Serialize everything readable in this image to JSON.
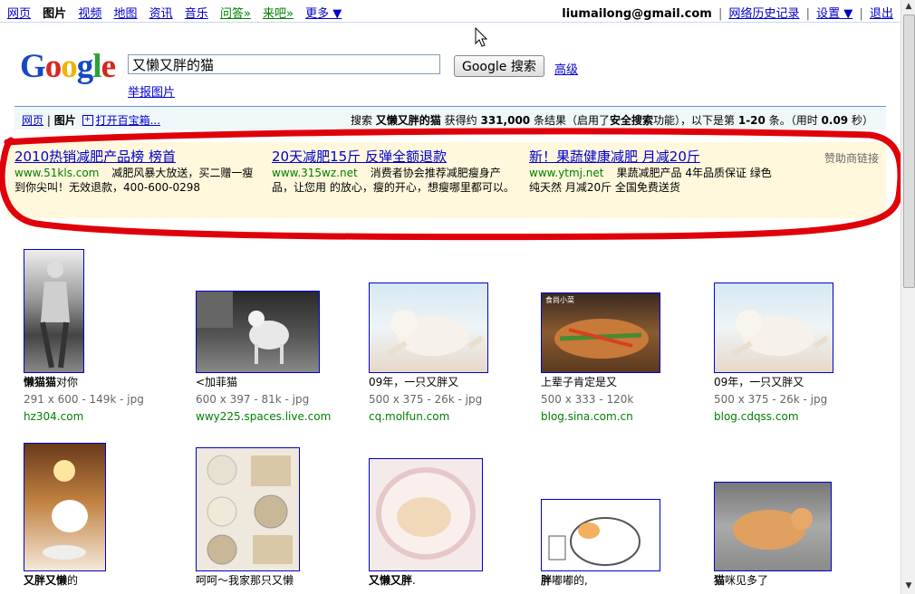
{
  "topnav": {
    "items": [
      "网页",
      "图片",
      "视频",
      "地图",
      "资讯",
      "音乐",
      "问答»",
      "来吧»",
      "更多 ▼"
    ],
    "account_email": "liumailong@gmail.com",
    "history": "网络历史记录",
    "settings": "设置 ▼",
    "signout": "退出"
  },
  "search": {
    "query": "又懒又胖的猫",
    "button": "Google 搜索",
    "advanced": "高级",
    "report": "举报图片"
  },
  "logo": {
    "l1": "G",
    "l2": "o",
    "l3": "o",
    "l4": "g",
    "l5": "l",
    "l6": "e"
  },
  "resultbar": {
    "tab_web": "网页",
    "sep": "|",
    "tab_images": "图片",
    "toolbox": "打开百宝箱...",
    "summary_prefix": "搜索",
    "summary_query": "又懒又胖的猫",
    "summary_mid1": "获得约",
    "summary_count": "331,000",
    "summary_mid2": "条结果（启用了",
    "summary_safe": "安全搜索",
    "summary_mid3": "功能），以下是第",
    "summary_range": "1-20",
    "summary_end": "条。（用时",
    "summary_time": "0.09",
    "summary_sec": "秒）"
  },
  "ads": {
    "sponsor_label": "赞助商链接",
    "items": [
      {
        "title": "2010热销减肥产品榜 榜首",
        "url": "www.51kls.com",
        "desc": "减肥风暴大放送，买二赠一瘦到你尖叫！无效退款，400-600-0298"
      },
      {
        "title": "20天减肥15斤 反弹全额退款",
        "url": "www.315wz.net",
        "desc": "消费者协会推荐减肥瘦身产品，让您用 的放心，瘦的开心，想瘦哪里都可以。"
      },
      {
        "title": "新！果蔬健康减肥 月减20斤",
        "url": "www.ytmj.net",
        "desc": "果蔬减肥产品 4年品质保证 绿色纯天然 月减20斤 全国免费送货"
      }
    ]
  },
  "images": [
    {
      "title_bold": "懒猫猫",
      "title_rest": "对你",
      "meta": "291 x 600 - 149k - jpg",
      "host": "hz304.com"
    },
    {
      "title_bold": "",
      "title_rest": "<加菲猫",
      "meta": "600 x 397 - 81k - jpg",
      "host": "wwy225.spaces.live.com"
    },
    {
      "title_bold": "",
      "title_rest": "09年，一只又胖又",
      "meta": "500 x 375 - 26k - jpg",
      "host": "cq.molfun.com"
    },
    {
      "title_bold": "",
      "title_rest": "上辈子肯定是又",
      "meta": "500 x 333 - 120k",
      "host": "blog.sina.com.cn"
    },
    {
      "title_bold": "",
      "title_rest": "09年，一只又胖又",
      "meta": "500 x 375 - 26k - jpg",
      "host": "blog.cdqss.com"
    },
    {
      "title_bold": "又胖又懒",
      "title_rest": "的",
      "meta": "",
      "host": ""
    },
    {
      "title_bold": "",
      "title_rest": "呵呵～我家那只又懒",
      "meta": "",
      "host": ""
    },
    {
      "title_bold": "又懒又胖",
      "title_rest": ".",
      "meta": "",
      "host": ""
    },
    {
      "title_bold": "胖",
      "title_rest": "嘟嘟的,",
      "meta": "",
      "host": ""
    },
    {
      "title_bold": "猫",
      "title_rest": "咪见多了",
      "meta": "",
      "host": ""
    }
  ],
  "thumb_labels": [
    "食尚小菜"
  ],
  "colors": {
    "link": "#0000cc",
    "url_green": "#008000",
    "ad_bg": "#fff8dd",
    "ring": "#e0000a"
  }
}
